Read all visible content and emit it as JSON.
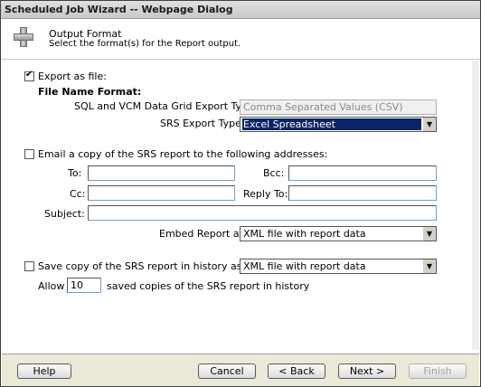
{
  "window": {
    "title": "Scheduled Job Wizard -- Webpage Dialog"
  },
  "header": {
    "title": "Output Format",
    "subtitle": "Select the format(s) for the Report output.",
    "icon": "plus-icon"
  },
  "export": {
    "checkbox_label": "Export as file:",
    "checked": true,
    "file_name_format_label": "File Name Format:",
    "sql_vcm_label": "SQL and VCM Data Grid Export Type",
    "sql_vcm_value": "Comma Separated Values (CSV)",
    "srs_label": "SRS Export Type",
    "srs_value": "Excel Spreadsheet"
  },
  "email": {
    "checkbox_label": "Email a copy of the SRS report to the following addresses:",
    "checked": false,
    "to_label": "To:",
    "to_value": "",
    "bcc_label": "Bcc:",
    "bcc_value": "",
    "cc_label": "Cc:",
    "cc_value": "",
    "reply_to_label": "Reply To:",
    "reply_to_value": "",
    "subject_label": "Subject:",
    "subject_value": "",
    "embed_label": "Embed Report as",
    "embed_value": "XML file with report data"
  },
  "history": {
    "checkbox_label": "Save copy of the SRS report in history as",
    "checked": false,
    "format_value": "XML file with report data",
    "allow_label": "Allow",
    "allow_value": "10",
    "copies_label": "saved copies of the SRS report in history"
  },
  "footer": {
    "help": "Help",
    "cancel": "Cancel",
    "back": "< Back",
    "next": "Next >",
    "finish": "Finish"
  }
}
